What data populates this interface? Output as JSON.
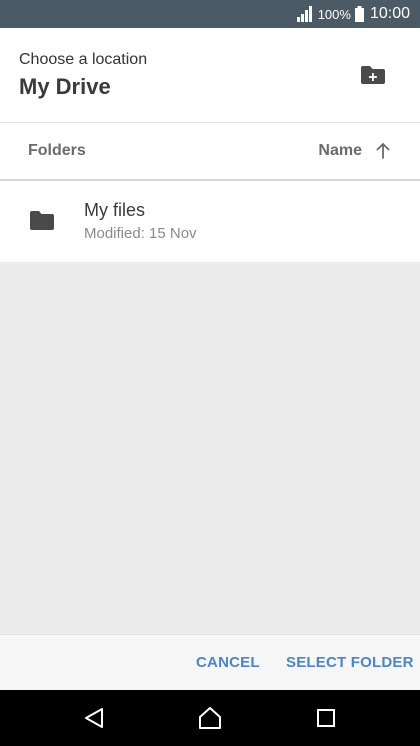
{
  "status_bar": {
    "battery_percent": "100%",
    "time": "10:00",
    "icons": [
      "signal-icon",
      "battery-icon"
    ]
  },
  "header": {
    "subtitle": "Choose a location",
    "title": "My Drive",
    "new_folder_icon": "new-folder-icon"
  },
  "column_header": {
    "folders_label": "Folders",
    "sort_label": "Name",
    "sort_icon": "arrow-up-icon"
  },
  "folders": [
    {
      "name": "My files",
      "modified": "Modified: 15 Nov",
      "icon": "folder-icon"
    }
  ],
  "actions": {
    "cancel_label": "CANCEL",
    "select_label": "SELECT FOLDER"
  },
  "nav": {
    "icons": [
      "back-icon",
      "home-icon",
      "recent-apps-icon"
    ]
  },
  "colors": {
    "status_bar": "#4c5a66",
    "accent": "#4b86c5",
    "background": "#ececec"
  }
}
